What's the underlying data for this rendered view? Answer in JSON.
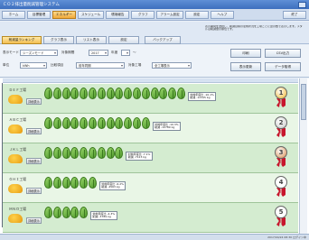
{
  "app_title": "ＣＯ２排出量削減管理システム",
  "menu": [
    "ホーム",
    "目標管理",
    "エネルギー",
    "スケジュール",
    "環境報告",
    "グラフ",
    "アラーム設定",
    "設定",
    "ヘルプ"
  ],
  "menu_active_index": 2,
  "menu_end": "終了",
  "subtabs": {
    "tab1": "削減量ランキング",
    "tab2": "グラフ表示",
    "tab3": "リスト表示",
    "tab4": "設定",
    "tab5": "バックアップ"
  },
  "note_text": "表示期間を選択し、削減目標の達成状況を工場ごとに葉の数で表示します。メダルは削減量の順位です。",
  "filters": {
    "label_area": "表示モード",
    "area_value": "シーズンモード",
    "label_year": "対象期間",
    "year_value": "2017",
    "label_year_unit": "年度",
    "label_to": "～",
    "label_unit": "単位",
    "unit_value": "kWh",
    "label_item": "比較項目",
    "item_value": "前年同期",
    "label_target": "対象工場",
    "target_value": "全工場表示",
    "print_label": "印刷",
    "csv_label": "CSV出力",
    "show_label": "表示更新",
    "data_label": "データ取得"
  },
  "detail_button_label": "詳細表示",
  "rows": [
    {
      "name": "ＤＥＦ工場",
      "leaves": 16,
      "note1": "対前年度比 -10.1%",
      "note2": "削減 -12345 kg",
      "rank": 1,
      "medal_color": "#f0b428",
      "ribbon_color": "#c7162c"
    },
    {
      "name": "ＡＢＣ工場",
      "leaves": 12,
      "note1": "対前年度比 -10.3%",
      "note2": "削減 -10789 kg",
      "rank": 2,
      "medal_color": "#c8c8c8",
      "ribbon_color": "#c7162c"
    },
    {
      "name": "ＪＫＬ工場",
      "leaves": 9,
      "note1": "対前年度比 -7.1%",
      "note2": "削減 -7123 kg",
      "rank": 3,
      "medal_color": "#d6894a",
      "ribbon_color": "#c7162c"
    },
    {
      "name": "ＧＨＩ工場",
      "leaves": 6,
      "note1": "対前年度比 -6.2%",
      "note2": "削減 -4563 kg",
      "rank": 4,
      "medal_color": "#ffffff",
      "ribbon_color": "#c7162c"
    },
    {
      "name": "ＭＮＯ工場",
      "leaves": 5,
      "note1": "対前年度比 -4.3%",
      "note2": "削減 -3789 kg",
      "rank": 5,
      "medal_color": "#ffffff",
      "ribbon_color": "#c7162c"
    }
  ],
  "status_text": "2017/04/24 08:30 ログイン中",
  "colors": {
    "accent": "#f0a93a",
    "row_even": "#d4ecd0",
    "row_odd": "#e9f6e6",
    "leaf": "#5aa836"
  }
}
